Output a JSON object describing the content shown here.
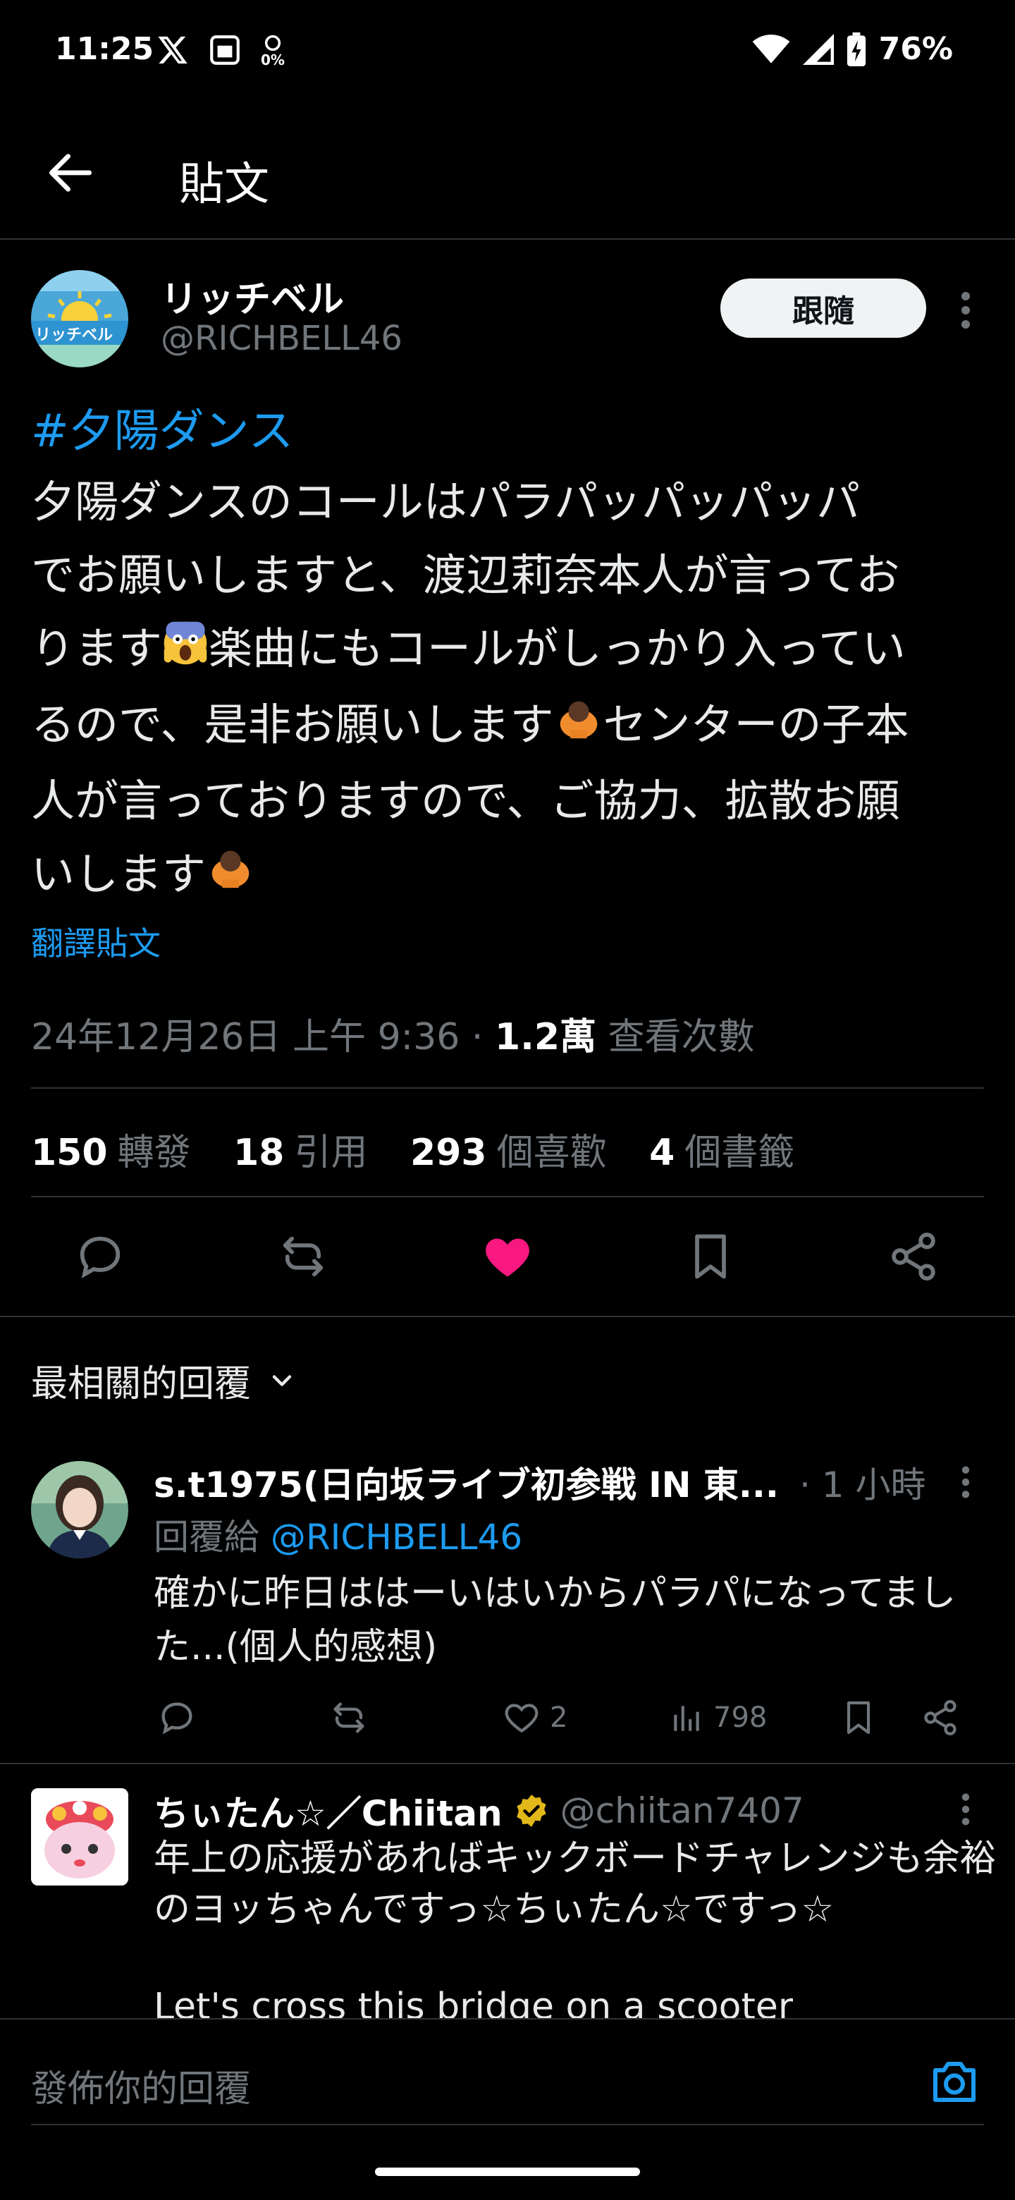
{
  "status_bar": {
    "time": "11:25",
    "notif_percent": "0%",
    "battery": "76%"
  },
  "header": {
    "title": "貼文"
  },
  "post": {
    "author_name": "リッチベル",
    "author_handle": "@RICHBELL46",
    "avatar_text": "リッチベル",
    "follow_label": "跟隨",
    "hashtag": "#夕陽ダンス",
    "body_lines": [
      "夕陽ダンスのコールはパラパッパッパッパ",
      "でお願いしますと、渡辺莉奈本人が言ってお",
      "ります",
      "楽曲にもコールがしっかり入ってい",
      "るので、是非お願いします",
      "センターの子本",
      "人が言っておりますので、ご協力、拡散お願",
      "いします"
    ],
    "translate_label": "翻譯貼文",
    "date": "24年12月26日 上午 9:36",
    "separator": "·",
    "views_count": "1.2萬",
    "views_label": "查看次數",
    "stats": {
      "reposts_count": "150",
      "reposts_label": "轉發",
      "quotes_count": "18",
      "quotes_label": "引用",
      "likes_count": "293",
      "likes_label": "個喜歡",
      "bookmarks_count": "4",
      "bookmarks_label": "個書籤"
    },
    "like_color": "#f91880"
  },
  "replies_header": {
    "label": "最相關的回覆"
  },
  "replies": [
    {
      "name": "s.t1975(日向坂ライブ初参戦 IN 東...",
      "time": "· 1 小時",
      "reply_to_label": "回覆給",
      "reply_to_handle": "@RICHBELL46",
      "text": "確かに昨日ははーいはいからパラパになってました...(個人的感想)",
      "likes": "2",
      "views": "798"
    },
    {
      "name": "ちぃたん☆／Chiitan",
      "handle": "@chiitan7407",
      "text": "年上の応援があればキックボードチャレンジも余裕のヨッちゃんですっ☆ちぃたん☆ですっ☆",
      "text_english": "Let's cross this bridge on a scooter"
    }
  ],
  "compose": {
    "placeholder": "發佈你的回覆"
  },
  "colors": {
    "accent": "#1d9bf0",
    "background": "#000000",
    "divider": "#2f3336",
    "secondary_text": "#71767b"
  }
}
